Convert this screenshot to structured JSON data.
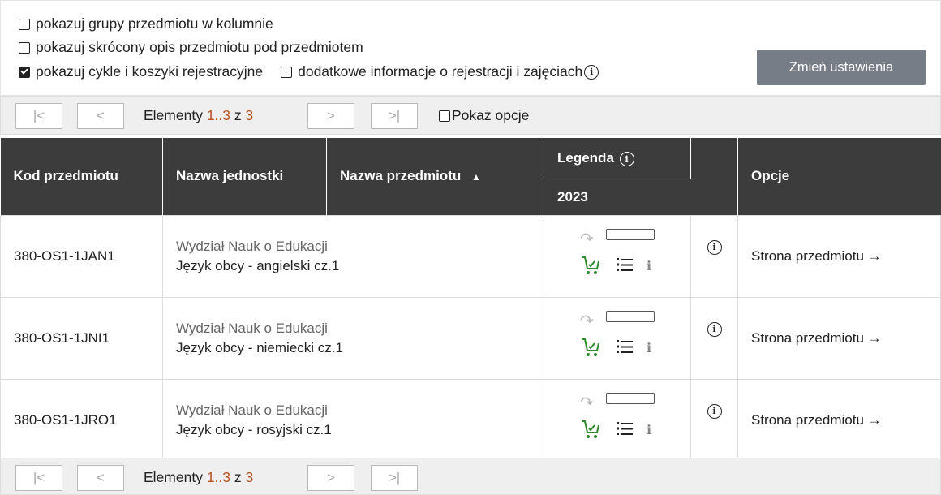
{
  "settings": {
    "option1": "pokazuj grupy przedmiotu w kolumnie",
    "option2": "pokazuj skrócony opis przedmiotu pod przedmiotem",
    "option3": "pokazuj cykle i koszyki rejestracyjne",
    "option4": "dodatkowe informacje o rejestracji i zajęciach",
    "option1_checked": false,
    "option2_checked": false,
    "option3_checked": true,
    "option4_checked": false,
    "apply_button": "Zmień ustawienia",
    "info_icon": "info-circle-icon"
  },
  "pager_top": {
    "first": "|<",
    "prev": "<",
    "next": ">",
    "last": ">|",
    "label": "Elementy",
    "range": "1..3",
    "of": "z",
    "total": "3",
    "show_options": "Pokaż opcje"
  },
  "table": {
    "headers": {
      "code": "Kod przedmiotu",
      "unit": "Nazwa jednostki",
      "subject": "Nazwa przedmiotu",
      "legend": "Legenda",
      "year": "2023",
      "options": "Opcje"
    },
    "rows": [
      {
        "code": "380-OS1-1JAN1",
        "unit": "Wydział Nauk o Edukacji",
        "subject": "Język obcy - angielski cz.1",
        "link": "Strona przedmiotu →"
      },
      {
        "code": "380-OS1-1JNI1",
        "unit": "Wydział Nauk o Edukacji",
        "subject": "Język obcy - niemiecki cz.1",
        "link": "Strona przedmiotu →"
      },
      {
        "code": "380-OS1-1JRO1",
        "unit": "Wydział Nauk o Edukacji",
        "subject": "Język obcy - rosyjski cz.1",
        "link": "Strona przedmiotu →"
      }
    ]
  },
  "pager_bottom": {
    "first": "|<",
    "prev": "<",
    "next": ">",
    "last": ">|",
    "label": "Elementy",
    "range": "1..3",
    "of": "z",
    "total": "3"
  },
  "colors": {
    "header_bg": "#3c3c3c",
    "accent_number": "#b5511e",
    "cart_green": "#2e8a2e",
    "apply_button": "#767d86"
  }
}
